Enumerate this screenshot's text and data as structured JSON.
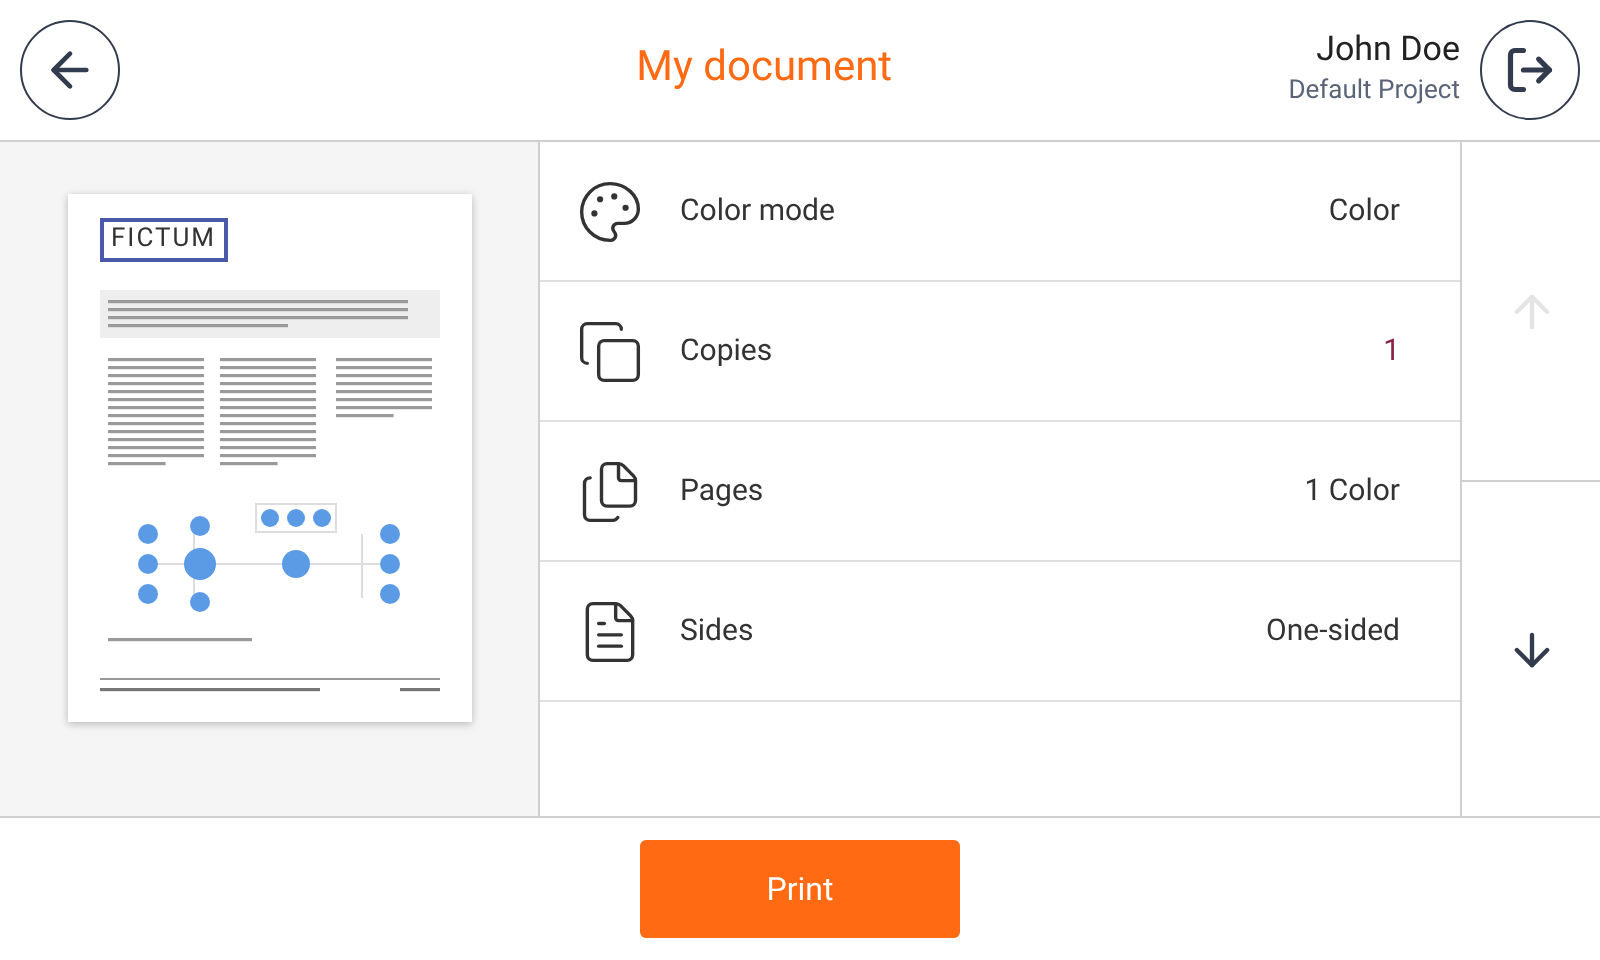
{
  "header": {
    "title": "My document",
    "user_name": "John Doe",
    "project": "Default Project"
  },
  "preview": {
    "logo": "FICTUM"
  },
  "settings": [
    {
      "kind": "color",
      "label": "Color mode",
      "value": "Color",
      "highlight": false
    },
    {
      "kind": "copies",
      "label": "Copies",
      "value": "1",
      "highlight": true
    },
    {
      "kind": "pages",
      "label": "Pages",
      "value": "1 Color",
      "highlight": false
    },
    {
      "kind": "sides",
      "label": "Sides",
      "value": "One-sided",
      "highlight": false
    }
  ],
  "scroll": {
    "up_disabled": true,
    "down_disabled": false
  },
  "print_button": "Print"
}
